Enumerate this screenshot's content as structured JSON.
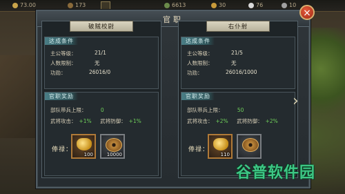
{
  "topbar": {
    "res1": "73.00",
    "res2": "173",
    "res3": "6613",
    "res4": "30",
    "res5": "76",
    "res6": "10"
  },
  "dialog": {
    "title": "官职",
    "close_label": "×",
    "next_label": "›"
  },
  "left": {
    "rank": "破贼校尉",
    "cond_header": "达成条件",
    "cond_rows": [
      {
        "label": "主公等级：",
        "value": "21/1"
      },
      {
        "label": "人数限制：",
        "value": "无"
      },
      {
        "label": "功勋：",
        "value": "26016/0"
      }
    ],
    "reward_header": "官职奖励",
    "troop_label": "部队带兵上限：",
    "troop_value": "0",
    "atk_label": "武将攻击：",
    "atk_value": "+1%",
    "def_label": "武将防御：",
    "def_value": "+1%",
    "salary_label": "俸禄：",
    "items": [
      {
        "icon": "gold-ingot-icon",
        "qty": "100"
      },
      {
        "icon": "copper-coin-icon",
        "qty": "10000"
      }
    ]
  },
  "right": {
    "rank": "右仆射",
    "cond_header": "达成条件",
    "cond_rows": [
      {
        "label": "主公等级：",
        "value": "21/5"
      },
      {
        "label": "人数限制：",
        "value": "无"
      },
      {
        "label": "功勋：",
        "value": "26016/1000"
      }
    ],
    "reward_header": "官职奖励",
    "troop_label": "部队带兵上限：",
    "troop_value": "50",
    "atk_label": "武将攻击：",
    "atk_value": "+2%",
    "def_label": "武将防御：",
    "def_value": "+2%",
    "salary_label": "俸禄：",
    "items": [
      {
        "icon": "gold-ingot-icon",
        "qty": "110"
      },
      {
        "icon": "copper-coin-icon",
        "qty": ""
      }
    ]
  },
  "watermark": "谷普软件园",
  "colors": {
    "accent_green": "#6fcf5a",
    "header_teal": "#4a7e86",
    "item_border_gold": "#b07a38",
    "close_red": "#c8361e"
  }
}
